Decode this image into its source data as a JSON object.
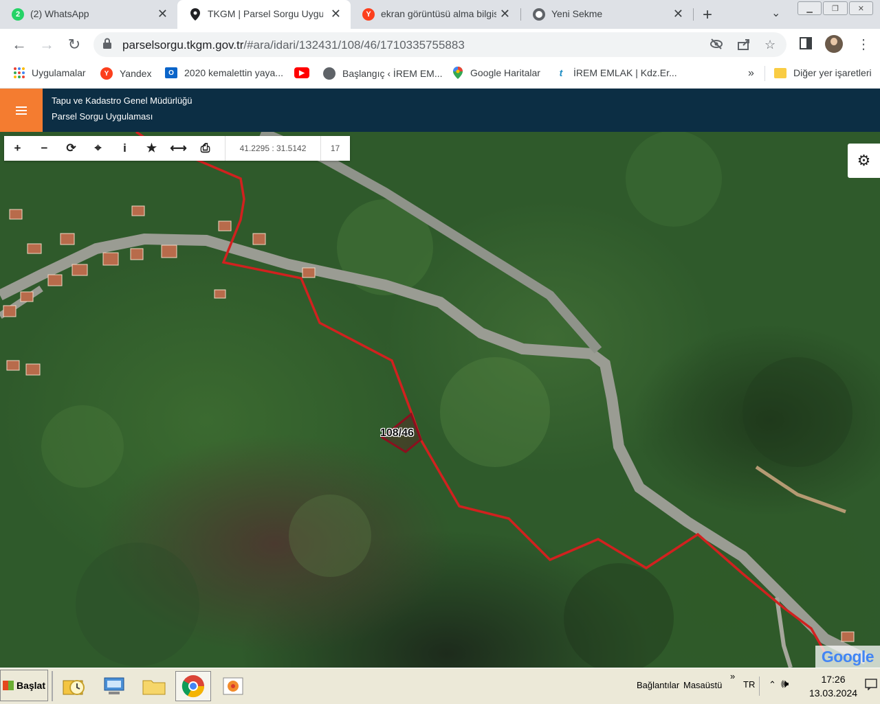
{
  "browser": {
    "tabs": [
      {
        "title": "(2) WhatsApp",
        "favicon": "whatsapp-icon",
        "badge": "2",
        "active": false
      },
      {
        "title": "TKGM | Parsel Sorgu Uygula",
        "favicon": "map-pin-icon",
        "active": true
      },
      {
        "title": "ekran görüntüsü alma bilgis",
        "favicon": "yandex-icon",
        "active": false
      },
      {
        "title": "Yeni Sekme",
        "favicon": "chrome-icon",
        "active": false
      }
    ],
    "close_glyph": "✕",
    "new_tab_glyph": "+",
    "tab_list_glyph": "⌄",
    "url_host": "parselsorgu.tkgm.gov.tr",
    "url_path": "/#ara/idari/132431/108/46/1710335755883"
  },
  "bookmarks": [
    {
      "label": "Uygulamalar",
      "icon": "apps-grid-icon"
    },
    {
      "label": "Yandex",
      "icon": "yandex-icon"
    },
    {
      "label": "2020 kemalettin yaya...",
      "icon": "outlook-icon"
    },
    {
      "label": "",
      "icon": "youtube-icon"
    },
    {
      "label": "Başlangıç ‹ İREM EM...",
      "icon": "globe-icon"
    },
    {
      "label": "Google Haritalar",
      "icon": "google-maps-icon"
    },
    {
      "label": "İREM EMLAK | Kdz.Er...",
      "icon": "site-icon"
    }
  ],
  "bookmarks_overflow": "»",
  "other_bookmarks": "Diğer yer işaretleri",
  "app": {
    "title_line1": "Tapu ve Kadastro Genel Müdürlüğü",
    "title_line2": "Parsel Sorgu Uygulaması"
  },
  "map": {
    "coordinates": "41.2295 : 31.5142",
    "zoom": "17",
    "parcel_label": "108/46",
    "attribution": "Google"
  },
  "taskbar": {
    "start_label": "Başlat",
    "tray_links": "Bağlantılar",
    "tray_desktop": "Masaüstü",
    "tray_overflow": "»",
    "language": "TR",
    "time": "17:26",
    "date": "13.03.2024"
  }
}
